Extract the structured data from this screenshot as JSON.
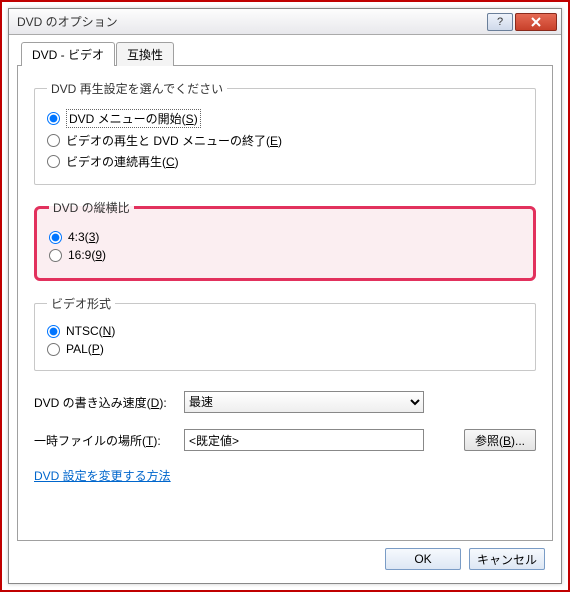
{
  "title": "DVD のオプション",
  "tabs": {
    "video": "DVD - ビデオ",
    "compat": "互換性",
    "active": "video"
  },
  "playback": {
    "legend": "DVD 再生設定を選んでください",
    "opt1_pre": "DVD メニューの開始(",
    "opt1_key": "S",
    "opt1_post": ")",
    "opt2_pre": "ビデオの再生と DVD メニューの終了(",
    "opt2_key": "E",
    "opt2_post": ")",
    "opt3_pre": "ビデオの連続再生(",
    "opt3_key": "C",
    "opt3_post": ")",
    "selected": 1
  },
  "aspect": {
    "legend": "DVD の縦横比",
    "opt1_pre": "4:3(",
    "opt1_key": "3",
    "opt1_post": ")",
    "opt2_pre": "16:9(",
    "opt2_key": "9",
    "opt2_post": ")",
    "selected": 1
  },
  "format": {
    "legend": "ビデオ形式",
    "opt1_pre": "NTSC(",
    "opt1_key": "N",
    "opt1_post": ")",
    "opt2_pre": "PAL(",
    "opt2_key": "P",
    "opt2_post": ")",
    "selected": 1
  },
  "speed_label_pre": "DVD の書き込み速度(",
  "speed_label_key": "D",
  "speed_label_post": "):",
  "speed_value": "最速",
  "temp_label_pre": "一時ファイルの場所(",
  "temp_label_key": "T",
  "temp_label_post": "):",
  "temp_value": "<既定値>",
  "browse_pre": "参照(",
  "browse_key": "B",
  "browse_post": ")...",
  "link_text": "DVD 設定を変更する方法",
  "ok": "OK",
  "cancel": "キャンセル"
}
